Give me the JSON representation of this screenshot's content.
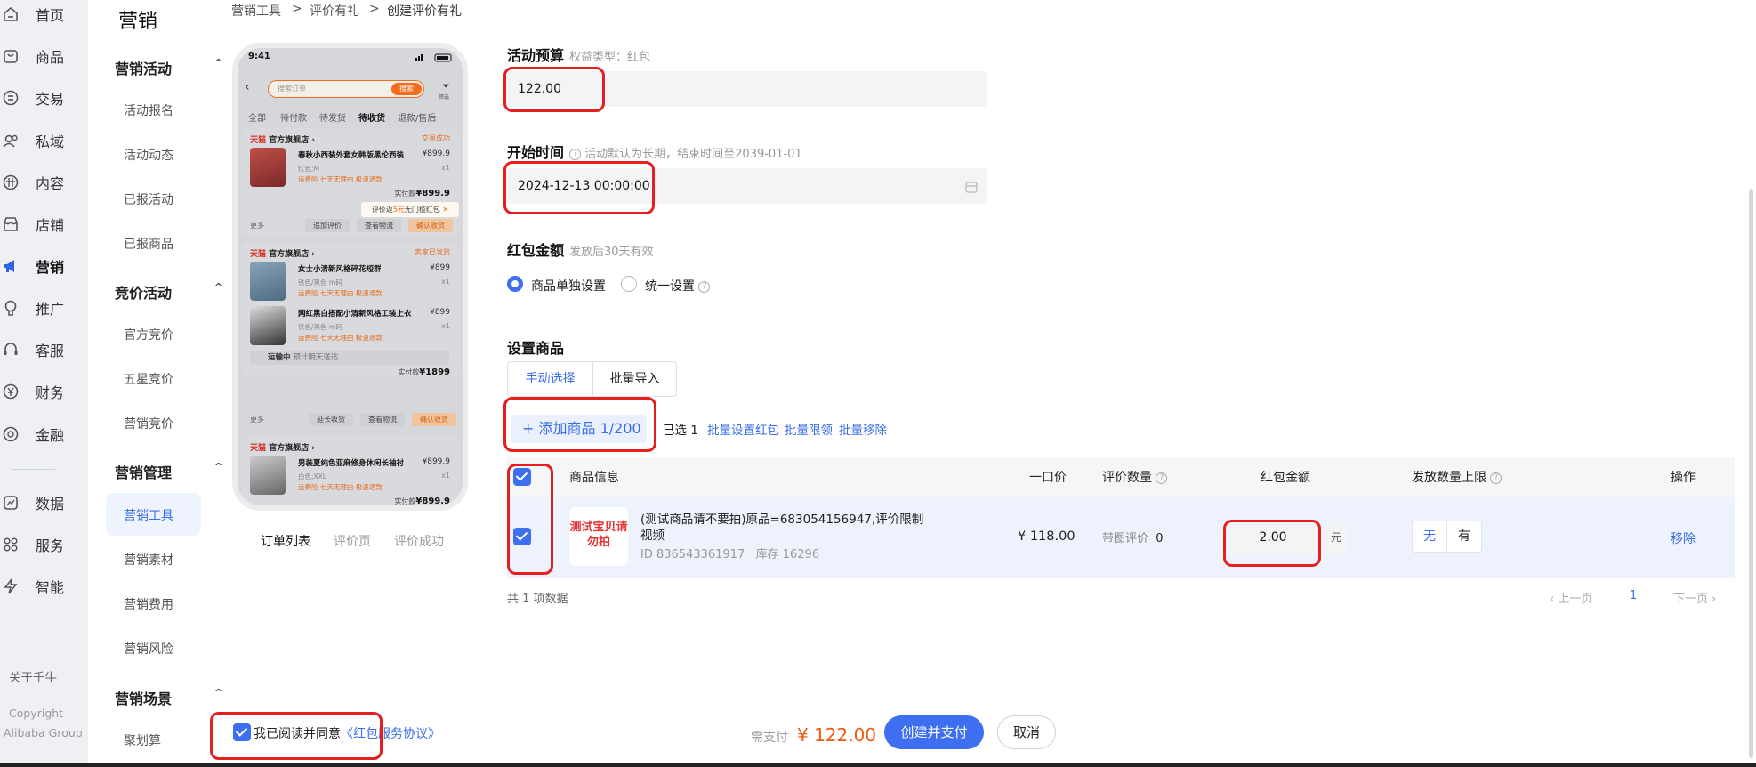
{
  "nav": {
    "items": [
      {
        "label": "首页",
        "icon": "home-icon"
      },
      {
        "label": "商品",
        "icon": "goods-icon"
      },
      {
        "label": "交易",
        "icon": "trade-icon"
      },
      {
        "label": "私域",
        "icon": "private-domain-icon"
      },
      {
        "label": "内容",
        "icon": "content-icon"
      },
      {
        "label": "店铺",
        "icon": "shop-icon"
      },
      {
        "label": "营销",
        "icon": "megaphone-icon"
      },
      {
        "label": "推广",
        "icon": "promotion-icon"
      },
      {
        "label": "客服",
        "icon": "headset-icon"
      },
      {
        "label": "财务",
        "icon": "finance-icon"
      },
      {
        "label": "金融",
        "icon": "money-icon"
      },
      {
        "label": "数据",
        "icon": "chart-icon"
      },
      {
        "label": "服务",
        "icon": "grid-icon"
      },
      {
        "label": "智能",
        "icon": "lightning-icon"
      }
    ],
    "about": "关于千牛",
    "copyright": "Copyright",
    "company": "Alibaba Group"
  },
  "subnav": {
    "title": "营销",
    "groups": [
      {
        "heading": "营销活动",
        "items": [
          "活动报名",
          "活动动态",
          "已报活动",
          "已报商品"
        ]
      },
      {
        "heading": "竞价活动",
        "items": [
          "官方竞价",
          "五星竞价",
          "营销竞价"
        ]
      },
      {
        "heading": "营销管理",
        "items": [
          "营销工具",
          "营销素材",
          "营销费用",
          "营销风险"
        ]
      },
      {
        "heading": "营销场景",
        "items": [
          "聚划算"
        ]
      }
    ]
  },
  "breadcrumb": {
    "items": [
      "营销工具",
      "评价有礼",
      "创建评价有礼"
    ],
    "sep": ">"
  },
  "preview": {
    "time": "9:41",
    "search_placeholder": "搜索订单",
    "search_btn": "搜索",
    "filter": "筛选",
    "tabs": [
      "全部",
      "待付款",
      "待发货",
      "待收货",
      "退款/售后"
    ],
    "tmall": "天猫",
    "shop": "官方旗舰店",
    "orders": [
      {
        "status": "交易成功",
        "name": "春秋小西装外套女韩版黑伦西装",
        "price": "¥899.9",
        "spec": "红色;M",
        "qty": "x1",
        "tags": "运费险  七天无理由  极速退款",
        "paid_label": "实付款",
        "paid": "¥899.9"
      },
      {
        "status": "卖家已发货",
        "name": "女士小清新风格碎花短群",
        "price": "¥899",
        "spec": "铁色/黑色 m码",
        "qty": "x1",
        "tags": "运费险  七天无理由  极速退款"
      },
      {
        "name": "网红黑白搭配小清新风格工装上衣",
        "price": "¥899",
        "spec": "铁色/黑色 m码",
        "qty": "x1",
        "tags": "运费险  七天无理由  极速退款",
        "ship_status": "运输中",
        "ship_note": "预计明天送达",
        "paid_label": "实付款",
        "paid": "¥1899"
      },
      {
        "name": "男装夏纯色亚麻修身休闲长袖衬",
        "price": "¥899.9",
        "spec": "白色;XXL",
        "qty": "x1",
        "tags": "运费险  七天无理由  极速退款",
        "paid_label": "实付款",
        "paid": "¥899.9"
      }
    ],
    "more": "更多",
    "btns1": [
      "追加评价",
      "查看物流",
      "确认收货"
    ],
    "btns2": [
      "延长收货",
      "查看物流",
      "确认收货"
    ],
    "coupon_pre": "评价返",
    "coupon_amt": "5元",
    "coupon_post": "无门槛红包",
    "coupon_close": "✕"
  },
  "preview_tabs": [
    "订单列表",
    "评价页",
    "评价成功"
  ],
  "form": {
    "budget_label": "活动预算",
    "budget_hint": "权益类型：红包",
    "budget_value": "122.00",
    "start_label": "开始时间",
    "start_hint": "活动默认为长期，结束时间至2039-01-01",
    "start_value": "2024-12-13 00:00:00",
    "amount_label": "红包金额",
    "amount_hint": "发放后30天有效",
    "radio_individual": "商品单独设置",
    "radio_unified": "统一设置",
    "goods_label": "设置商品",
    "tab_manual": "手动选择",
    "tab_batch": "批量导入",
    "add_goods": "+ 添加商品 1/200",
    "selected": "已选 1",
    "batch_links": [
      "批量设置红包",
      "批量限领",
      "批量移除"
    ]
  },
  "table": {
    "headers": [
      "商品信息",
      "一口价",
      "评价数量",
      "红包金额",
      "发放数量上限",
      "操作"
    ],
    "row": {
      "img_text": "测试宝贝请勿拍",
      "title": "(测试商品请不要拍)原品=683054156947,评价限制视频",
      "id": "ID 836543361917",
      "stock": "库存 16296",
      "price": "¥ 118.00",
      "review_label": "带图评价",
      "review_count": "0",
      "redpacket": "2.00",
      "unit": "元",
      "limit_no": "无",
      "limit_yes": "有",
      "action": "移除"
    },
    "total": "共 1 项数据",
    "prev": "‹ 上一页",
    "page": "1",
    "next": "下一页 ›"
  },
  "footer": {
    "agree": "我已阅读并同意",
    "agreement_link": "《红包服务协议》",
    "pay_label": "需支付",
    "pay_amount": "¥ 122.00",
    "create_btn": "创建并支付",
    "cancel_btn": "取消"
  },
  "colors": {
    "primary": "#3d6ff0",
    "highlight": "#e51f1f",
    "price": "#f05a14"
  }
}
